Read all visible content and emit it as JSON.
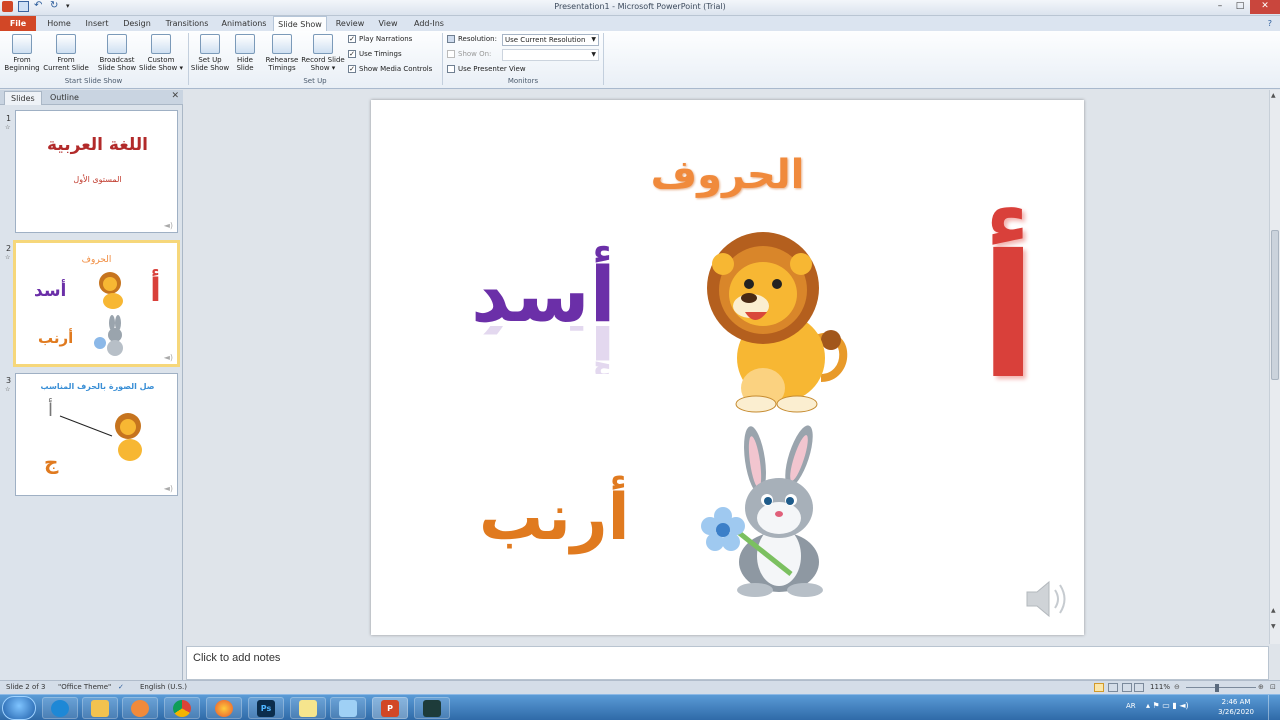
{
  "window": {
    "title": "Presentation1 - Microsoft PowerPoint (Trial)"
  },
  "tabs": [
    "File",
    "Home",
    "Insert",
    "Design",
    "Transitions",
    "Animations",
    "Slide Show",
    "Review",
    "View",
    "Add-Ins"
  ],
  "ribbon": {
    "from_beginning": "From\nBeginning",
    "from_current": "From\nCurrent Slide",
    "broadcast": "Broadcast\nSlide Show",
    "custom": "Custom\nSlide Show ▾",
    "group_start": "Start Slide Show",
    "setup_show": "Set Up\nSlide Show",
    "hide_slide": "Hide\nSlide",
    "rehearse": "Rehearse\nTimings",
    "record": "Record Slide\nShow ▾",
    "play_narrations": "Play Narrations",
    "use_timings": "Use Timings",
    "show_media": "Show Media Controls",
    "group_setup": "Set Up",
    "resolution_label": "Resolution:",
    "resolution_value": "Use Current Resolution",
    "show_on_label": "Show On:",
    "presenter_view": "Use Presenter View",
    "group_monitors": "Monitors"
  },
  "left_panel": {
    "tab_slides": "Slides",
    "tab_outline": "Outline",
    "close": "✕"
  },
  "thumbs": {
    "n1": "1",
    "n2": "2",
    "n3": "3",
    "s1_title": "اللغة العربية",
    "s1_sub": "المستوى الأول",
    "s2_title": "الحروف",
    "s2_word1": "أسد",
    "s2_word2": "أرنب",
    "s2_letter": "أ",
    "s3_title": "صل الصورة بالحرف المناسب",
    "s3_letter1": "أ",
    "s3_letter2": "ج"
  },
  "slide": {
    "title": "الحروف",
    "letter": "أ",
    "word1": "أسد",
    "word2": "أرنب"
  },
  "notes": {
    "placeholder": "Click to add notes"
  },
  "status": {
    "slide_of": "Slide 2 of 3",
    "theme": "\"Office Theme\"",
    "language": "English (U.S.)",
    "zoom": "111%"
  },
  "taskbar": {
    "lang": "AR",
    "time": "2:46 AM",
    "date": "3/26/2020"
  },
  "colors": {
    "file_tab": "#d24726",
    "title_orange": "#f08a3c",
    "word1_purple": "#6b2fa8",
    "word2_orange": "#e07a1f",
    "letter_red": "#d9403a"
  }
}
